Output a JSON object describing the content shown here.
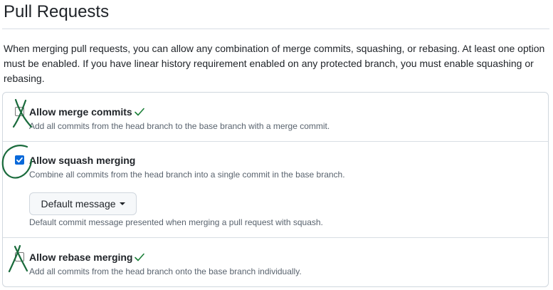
{
  "page": {
    "title": "Pull Requests",
    "intro": "When merging pull requests, you can allow any combination of merge commits, squashing, or rebasing. At least one option must be enabled. If you have linear history requirement enabled on any protected branch, you must enable squashing or rebasing."
  },
  "options": [
    {
      "label": "Allow merge commits",
      "description": "Add all commits from the head branch to the base branch with a merge commit.",
      "checked": false
    },
    {
      "label": "Allow squash merging",
      "description": "Combine all commits from the head branch into a single commit in the base branch.",
      "checked": true,
      "dropdown": {
        "label": "Default message",
        "note": "Default commit message presented when merging a pull request with squash."
      }
    },
    {
      "label": "Allow rebase merging",
      "description": "Add all commits from the head branch onto the base branch individually.",
      "checked": false
    }
  ],
  "icons": {
    "checkmark": "check-icon",
    "caret": "triangle-down-icon"
  },
  "colors": {
    "accent": "#0969da",
    "annotation": "#1a6b3c",
    "check": "#1a7f37"
  }
}
